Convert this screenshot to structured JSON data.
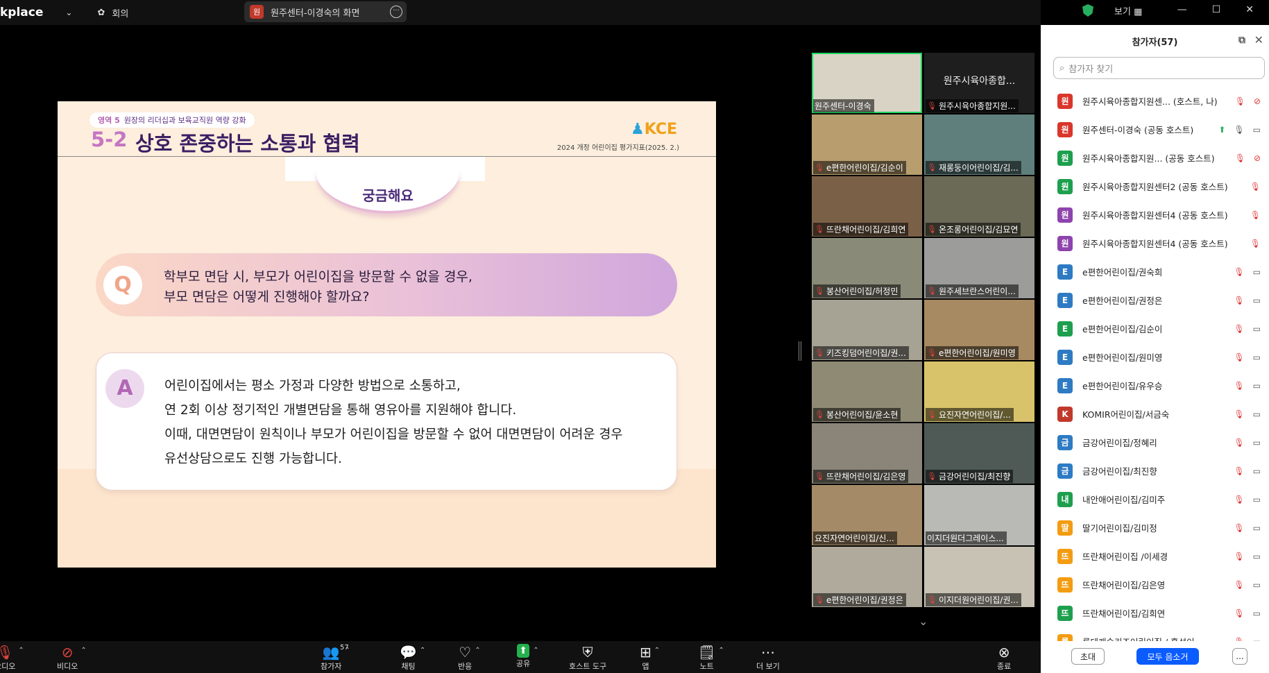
{
  "topbar": {
    "app_name": "kplace",
    "meeting_label": "회의",
    "share_avatar": "원",
    "share_title": "원주센터-이경숙의 화면",
    "view_label": "보기"
  },
  "slide": {
    "tag_area": "영역 5",
    "tag_text": "원장의 리더십과 보육교직원 역량 강화",
    "title_number": "5-2",
    "title": "상호 존중하는 소통과 협력",
    "logo": "KCE",
    "subtitle": "2024 개정 어린이집 평가지표(2025. 2.)",
    "curious_label": "궁금해요",
    "q_letter": "Q",
    "question_lines": [
      "학부모 면담 시, 부모가 어린이집을 방문할 수 없을 경우,",
      "부모 면담은 어떻게 진행해야 할까요?"
    ],
    "a_letter": "A",
    "answer_lines": [
      "어린이집에서는 평소 가정과 다양한 방법으로 소통하고,",
      "연 2회 이상 정기적인 개별면담을 통해 영유아를 지원해야 합니다.",
      "이때, 대면면담이 원칙이나 부모가 어린이집을 방문할 수 없어 대면면담이 어려운 경우",
      "유선상담으로도 진행 가능합니다."
    ]
  },
  "video_tiles": [
    "원주센터-이경숙",
    "원주시육아종합지원...",
    "e편한어린이집/김순이",
    "재롱둥이어린이집/김...",
    "뜨란채어린이집/김희연",
    "온조롱어린이집/김묘연",
    "봉산어린이집/허정민",
    "원주세브란스어린이...",
    "키즈킹덤어린이집/권...",
    "e편한어린이집/원미영",
    "봉산어린이집/윤소현",
    "요진자연어린이집/...",
    "뜨란채어린이집/김은영",
    "금강어린이집/최진향",
    "요진자연어린이집/신...",
    "이지더원더그레이스...",
    "e편한어린이집/권정은",
    "이지더원어린이집/권..."
  ],
  "video_big_name": "원주시육아종합...",
  "participants": {
    "title": "참가자(57)",
    "search_placeholder": "참가자 찾기",
    "list": [
      {
        "initial": "원",
        "color": "#d9372c",
        "name": "원주시육아종합지원센... (호스트, 나)"
      },
      {
        "initial": "원",
        "color": "#d9372c",
        "name": "원주센터-이경숙 (공동 호스트)"
      },
      {
        "initial": "원",
        "color": "#1e9f4e",
        "name": "원주시육아종합지원... (공동 호스트)"
      },
      {
        "initial": "원",
        "color": "#1e9f4e",
        "name": "원주시육아종합지원센터2 (공동 호스트)"
      },
      {
        "initial": "원",
        "color": "#8e44ad",
        "name": "원주시육아종합지원센터4 (공동 호스트)"
      },
      {
        "initial": "원",
        "color": "#8e44ad",
        "name": "원주시육아종합지원센터4 (공동 호스트)"
      },
      {
        "initial": "E",
        "color": "#2e7bc4",
        "name": "e편한어린이집/권숙희"
      },
      {
        "initial": "E",
        "color": "#2e7bc4",
        "name": "e편한어린이집/권정은"
      },
      {
        "initial": "E",
        "color": "#1e9f4e",
        "name": "e편한어린이집/김순이"
      },
      {
        "initial": "E",
        "color": "#2e7bc4",
        "name": "e편한어린이집/원미영"
      },
      {
        "initial": "E",
        "color": "#2e7bc4",
        "name": "e편한어린이집/유우승"
      },
      {
        "initial": "K",
        "color": "#c0392b",
        "name": "KOMIR어린이집/서금숙"
      },
      {
        "initial": "금",
        "color": "#2e7bc4",
        "name": "금강어린이집/정혜리"
      },
      {
        "initial": "금",
        "color": "#2e7bc4",
        "name": "금강어린이집/최진향"
      },
      {
        "initial": "내",
        "color": "#1e9f4e",
        "name": "내안애어린이집/김미주"
      },
      {
        "initial": "딸",
        "color": "#f39c12",
        "name": "딸기어린이집/김미정"
      },
      {
        "initial": "뜨",
        "color": "#f39c12",
        "name": "뜨란채어린이집 /이세경"
      },
      {
        "initial": "뜨",
        "color": "#f39c12",
        "name": "뜨란채어린이집/김은영"
      },
      {
        "initial": "뜨",
        "color": "#1e9f4e",
        "name": "뜨란채어린이집/김희연"
      },
      {
        "initial": "롯",
        "color": "#f39c12",
        "name": "롯데캐슬키즈어린이집 / 홍성이"
      }
    ],
    "invite_label": "초대",
    "muteall_label": "모두 음소거",
    "more_label": "..."
  },
  "toolbar": {
    "audio": "오디오",
    "video": "비디오",
    "participants": "참가자",
    "participants_count": "57",
    "chat": "채팅",
    "reactions": "반응",
    "share": "공유",
    "host_tools": "호스트 도구",
    "apps": "앱",
    "notes": "노트",
    "more": "더 보기",
    "end": "종료"
  }
}
